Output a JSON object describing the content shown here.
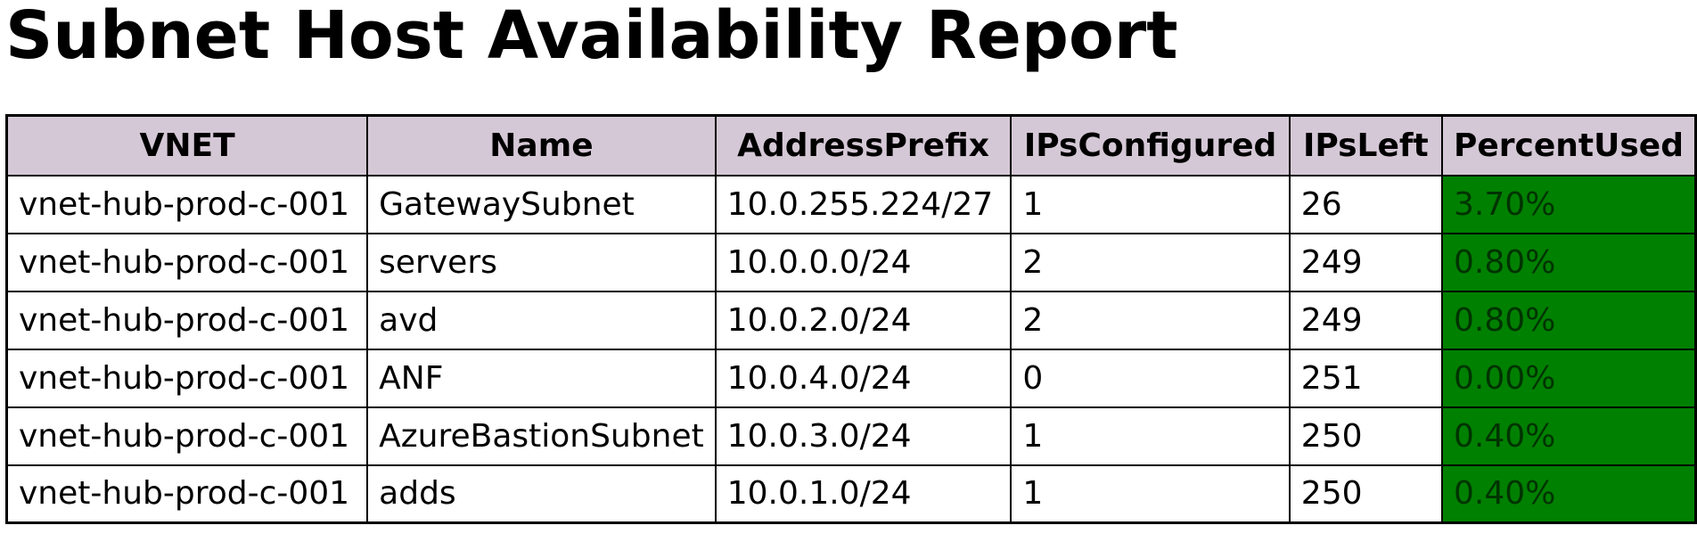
{
  "title": "Subnet Host Availability Report",
  "table": {
    "headers": [
      "VNET",
      "Name",
      "AddressPrefix",
      "IPsConfigured",
      "IPsLeft",
      "PercentUsed"
    ],
    "rows": [
      {
        "vnet": "vnet-hub-prod-c-001",
        "name": "GatewaySubnet",
        "prefix": "10.0.255.224/27",
        "configured": "1",
        "left": "26",
        "percent": "3.70%"
      },
      {
        "vnet": "vnet-hub-prod-c-001",
        "name": "servers",
        "prefix": "10.0.0.0/24",
        "configured": "2",
        "left": "249",
        "percent": "0.80%"
      },
      {
        "vnet": "vnet-hub-prod-c-001",
        "name": "avd",
        "prefix": "10.0.2.0/24",
        "configured": "2",
        "left": "249",
        "percent": "0.80%"
      },
      {
        "vnet": "vnet-hub-prod-c-001",
        "name": "ANF",
        "prefix": "10.0.4.0/24",
        "configured": "0",
        "left": "251",
        "percent": "0.00%"
      },
      {
        "vnet": "vnet-hub-prod-c-001",
        "name": "AzureBastionSubnet",
        "prefix": "10.0.3.0/24",
        "configured": "1",
        "left": "250",
        "percent": "0.40%"
      },
      {
        "vnet": "vnet-hub-prod-c-001",
        "name": "adds",
        "prefix": "10.0.1.0/24",
        "configured": "1",
        "left": "250",
        "percent": "0.40%"
      }
    ]
  },
  "colors": {
    "header_background": "#d5c8d6",
    "percent_cell_background": "#008000",
    "border": "#000000"
  }
}
